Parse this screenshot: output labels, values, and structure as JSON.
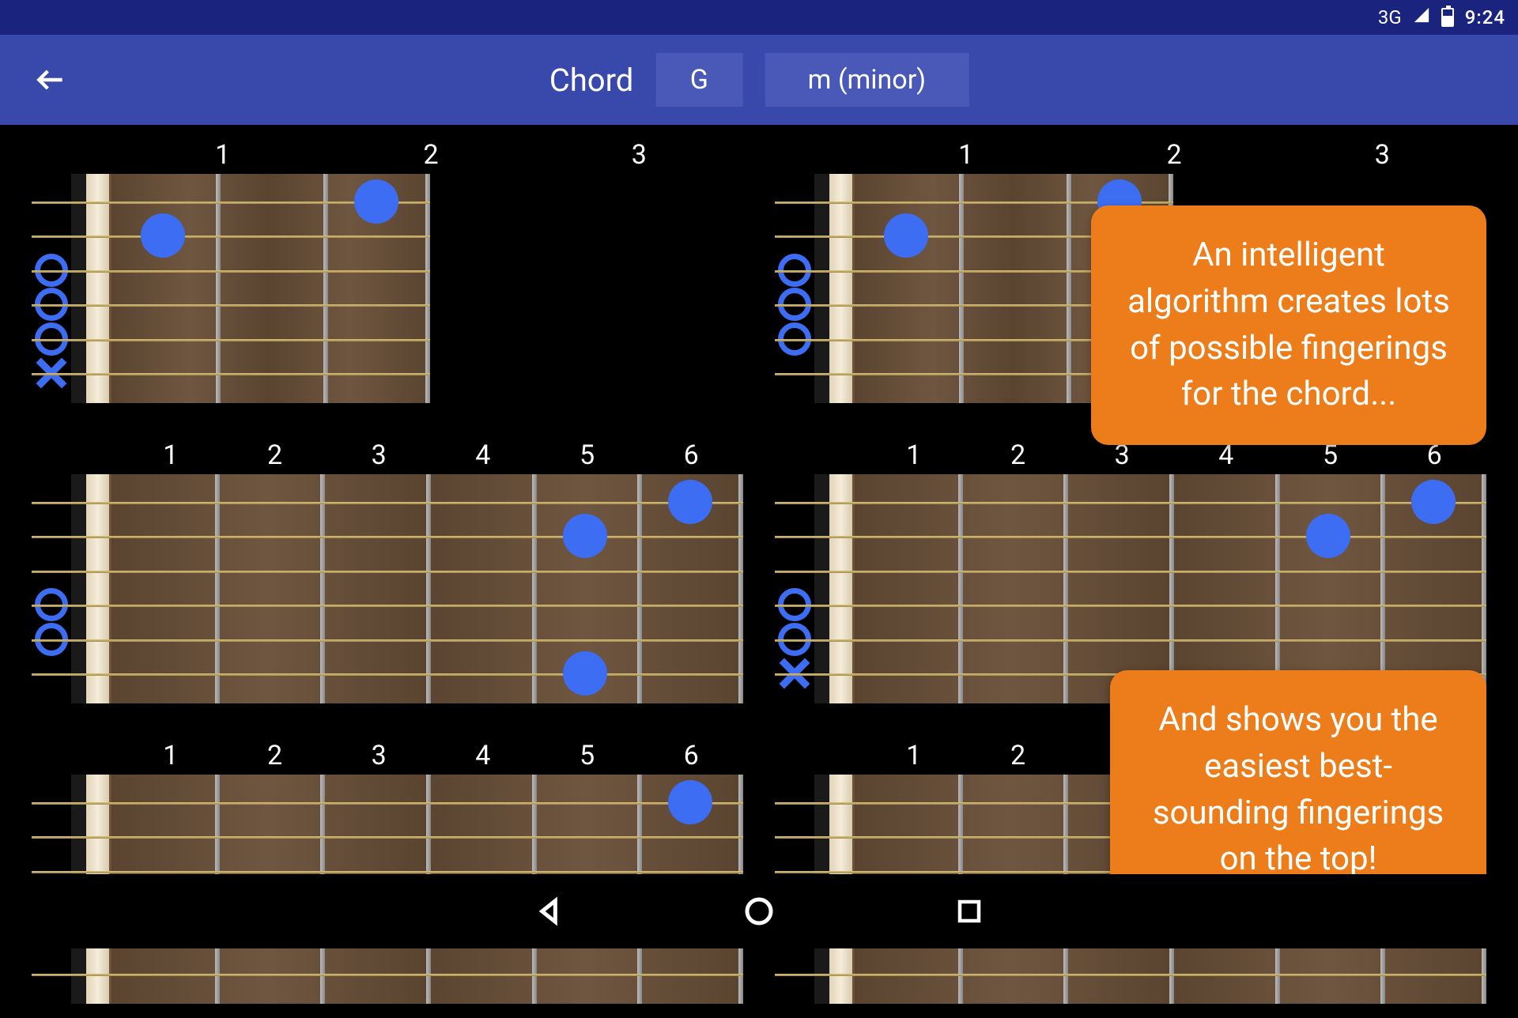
{
  "status": {
    "net": "3G",
    "time": "9:24"
  },
  "appbar": {
    "label": "Chord",
    "root": "G",
    "quality": "m (minor)"
  },
  "fretLabels3": [
    "1",
    "2",
    "3"
  ],
  "fretLabels6": [
    "1",
    "2",
    "3",
    "4",
    "5",
    "6"
  ],
  "callout1": "An intelligent algorithm creates lots of possible fingerings for the chord...",
  "callout2": "And shows you the easiest best-sounding fingerings on the top!",
  "boards": {
    "a": {
      "frets": 3,
      "open": [
        3,
        4,
        5
      ],
      "mute": [
        6
      ],
      "dots": [
        {
          "string": 1,
          "fret": 3
        },
        {
          "string": 2,
          "fret": 1
        }
      ]
    },
    "b": {
      "frets": 3,
      "open": [
        3,
        4,
        5
      ],
      "mute": [],
      "dots": [
        {
          "string": 1,
          "fret": 3
        },
        {
          "string": 2,
          "fret": 1
        }
      ]
    },
    "c": {
      "frets": 6,
      "open": [
        4,
        5
      ],
      "mute": [],
      "dots": [
        {
          "string": 1,
          "fret": 6
        },
        {
          "string": 2,
          "fret": 5
        },
        {
          "string": 6,
          "fret": 5
        }
      ]
    },
    "d": {
      "frets": 6,
      "open": [
        4,
        5
      ],
      "mute": [
        6
      ],
      "dots": [
        {
          "string": 1,
          "fret": 6
        },
        {
          "string": 2,
          "fret": 5
        }
      ]
    },
    "e": {
      "frets": 6,
      "open": [],
      "mute": [],
      "dots": [
        {
          "string": 1,
          "fret": 6
        }
      ]
    },
    "f": {
      "frets": 6,
      "open": [],
      "mute": [],
      "dots": []
    }
  }
}
